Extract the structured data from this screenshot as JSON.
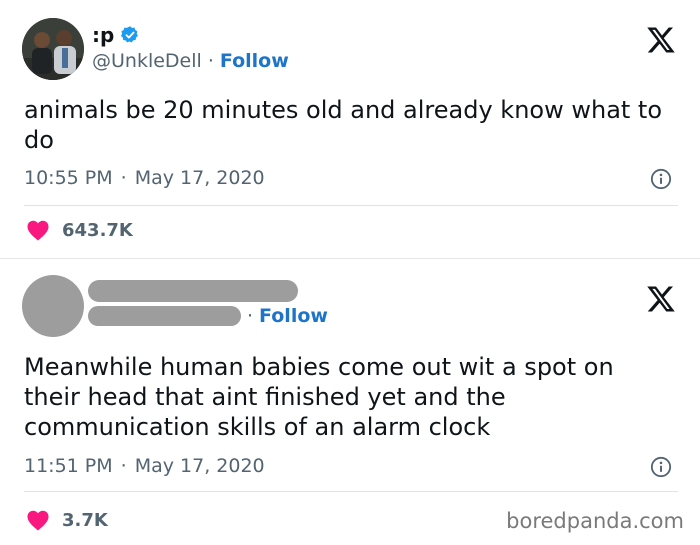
{
  "tweet1": {
    "display_name": ":p",
    "handle": "@UnkleDell",
    "separator": "·",
    "follow_label": "Follow",
    "text": "animals be 20 minutes old and already know what to do",
    "time": "10:55 PM",
    "date": "May 17, 2020",
    "likes": "643.7K"
  },
  "tweet2": {
    "separator": "·",
    "follow_label": "Follow",
    "text": "Meanwhile human babies come out wit a spot on their head that aint finished yet and the communication skills of an alarm clock",
    "time": "11:51 PM",
    "date": "May 17, 2020",
    "likes": "3.7K"
  },
  "meta_separator": "·",
  "watermark": "boredpanda.com",
  "colors": {
    "heart": "#f91880",
    "verified": "#1d9bf0",
    "follow": "#1d74c9",
    "redaction": "#9d9d9d"
  }
}
